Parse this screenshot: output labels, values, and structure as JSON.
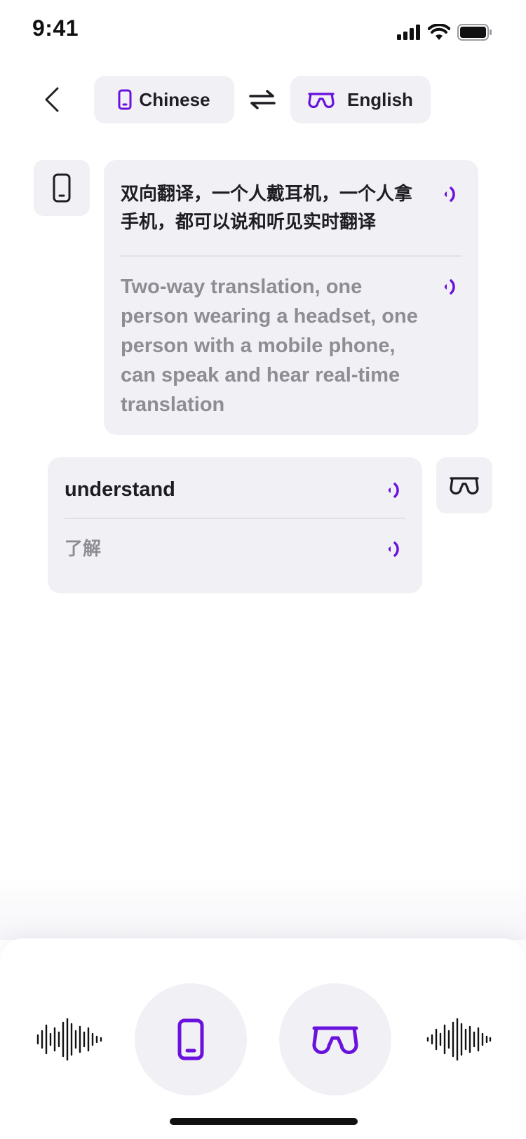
{
  "status_bar": {
    "time": "9:41",
    "icons": [
      "signal-icon",
      "wifi-icon",
      "battery-icon"
    ]
  },
  "header": {
    "back_icon": "chevron-left-icon",
    "source_language": {
      "label": "Chinese",
      "icon": "phone-icon"
    },
    "swap_icon": "swap-arrows-icon",
    "target_language": {
      "label": "English",
      "icon": "glasses-icon"
    }
  },
  "conversation": [
    {
      "speaker": "phone",
      "avatar_icon": "phone-icon",
      "source_text": "双向翻译，一个人戴耳机，一个人拿手机，都可以说和听见实时翻译",
      "translation": "Two-way translation, one person wearing a headset, one person with a mobile phone, can speak and hear real-time translation"
    },
    {
      "speaker": "glasses",
      "avatar_icon": "glasses-icon",
      "source_text": "understand",
      "translation": "了解"
    }
  ],
  "bottom_controls": {
    "left_wave": "sound-wave-icon",
    "phone_button_icon": "phone-icon",
    "glasses_button_icon": "glasses-icon",
    "right_wave": "sound-wave-icon"
  },
  "colors": {
    "accent": "#6a12dd",
    "bubble_bg": "#f1f0f5",
    "text_primary": "#1e1e22",
    "text_secondary": "#8e8d94"
  }
}
